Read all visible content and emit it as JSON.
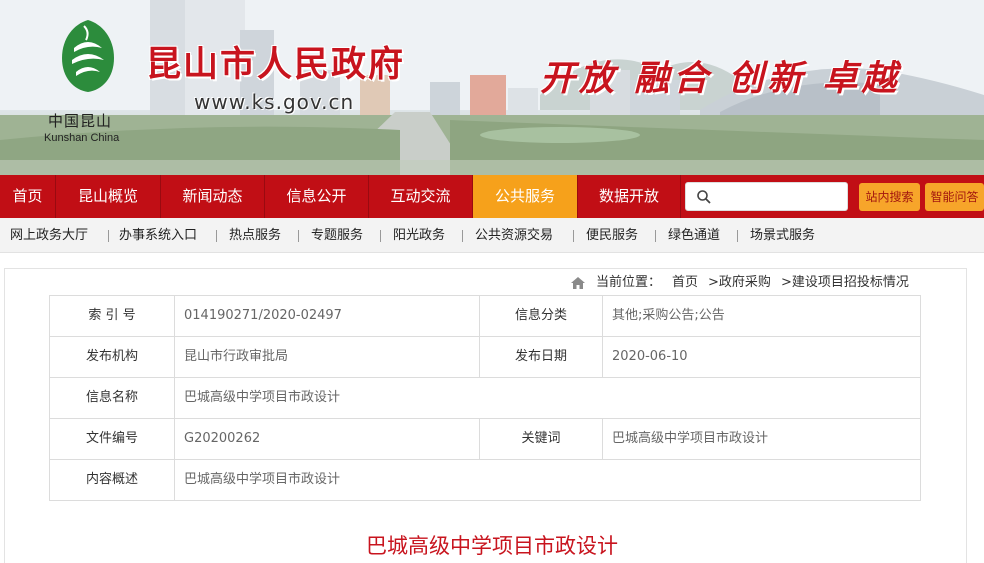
{
  "banner": {
    "site_title": "昆山市人民政府",
    "site_url": "www.ks.gov.cn",
    "logo_cn": "中国昆山",
    "logo_en": "Kunshan China",
    "slogan": "开放 融合 创新 卓越"
  },
  "nav": {
    "items": [
      {
        "label": "首页"
      },
      {
        "label": "昆山概览"
      },
      {
        "label": "新闻动态"
      },
      {
        "label": "信息公开"
      },
      {
        "label": "互动交流"
      },
      {
        "label": "公共服务",
        "active": true
      },
      {
        "label": "数据开放"
      }
    ],
    "search_placeholder": "",
    "site_search_label": "站内搜索",
    "smart_qa_label": "智能问答"
  },
  "subnav": {
    "items": [
      {
        "label": "网上政务大厅"
      },
      {
        "label": "办事系统入口"
      },
      {
        "label": "热点服务"
      },
      {
        "label": "专题服务"
      },
      {
        "label": "阳光政务"
      },
      {
        "label": "公共资源交易"
      },
      {
        "label": "便民服务"
      },
      {
        "label": "绿色通道"
      },
      {
        "label": "场景式服务"
      }
    ]
  },
  "breadcrumb": {
    "prefix": "当前位置：",
    "items": [
      "首页",
      ">政府采购",
      ">建设项目招投标情况"
    ]
  },
  "meta": {
    "index_label": "索 引 号",
    "index_value": "014190271/2020-02497",
    "category_label": "信息分类",
    "category_value": "其他;采购公告;公告",
    "publisher_label": "发布机构",
    "publisher_value": "昆山市行政审批局",
    "date_label": "发布日期",
    "date_value": "2020-06-10",
    "name_label": "信息名称",
    "name_value": "巴城高级中学项目市政设计",
    "docno_label": "文件编号",
    "docno_value": "G20200262",
    "keyword_label": "关键词",
    "keyword_value": "巴城高级中学项目市政设计",
    "summary_label": "内容概述",
    "summary_value": "巴城高级中学项目市政设计"
  },
  "article": {
    "title": "巴城高级中学项目市政设计"
  },
  "colors": {
    "brand_red": "#c10e15",
    "accent_orange": "#f6a11b",
    "title_red": "#c8141e"
  }
}
